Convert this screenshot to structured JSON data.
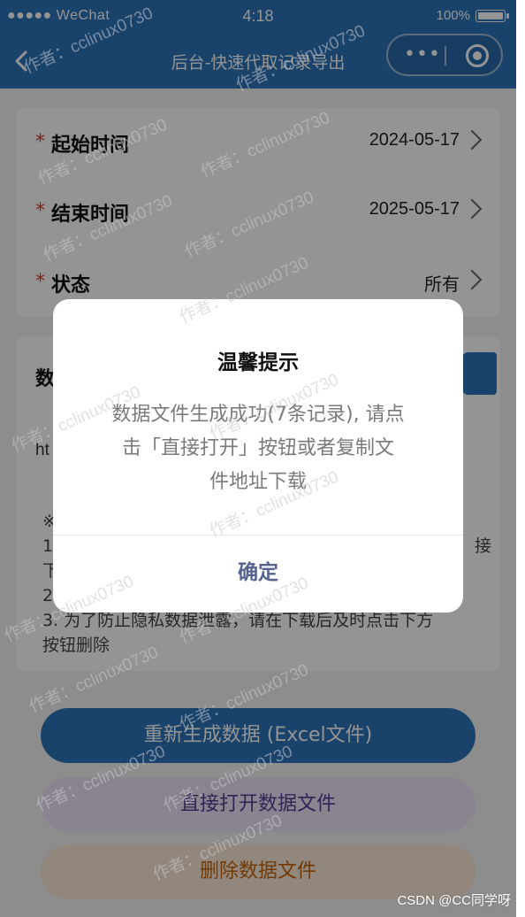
{
  "status_bar": {
    "carrier": "●●●●● WeChat",
    "time": "4:18",
    "battery": "100%"
  },
  "nav": {
    "title": "后台-快速代取记录导出",
    "capsule_more": "•••"
  },
  "form": {
    "required_mark": "*",
    "rows": [
      {
        "label": "起始时间",
        "value": "2024-05-17"
      },
      {
        "label": "结束时间",
        "value": "2025-05-17"
      },
      {
        "label": "状态",
        "value": "所有"
      }
    ]
  },
  "data_section": {
    "label_partial": "数",
    "url_partial": "ht",
    "note_mark": "※",
    "note_lines": [
      {
        "left": "1",
        "right": "接"
      },
      {
        "left": "下",
        "right": ""
      },
      {
        "left": "2",
        "right": ""
      },
      {
        "left": "3. 为了防止隐私数据泄露，请在下载后及时点击下方",
        "right": ""
      },
      {
        "left": "按钮删除",
        "right": ""
      }
    ]
  },
  "buttons": {
    "regenerate": "重新生成数据 (Excel文件)",
    "open": "直接打开数据文件",
    "delete": "删除数据文件"
  },
  "dialog": {
    "title": "温馨提示",
    "message_lines": [
      "数据文件生成成功(7条记录), 请点",
      "击「直接打开」按钮或者复制文",
      "件地址下载"
    ],
    "confirm": "确定"
  },
  "watermark_text": "作者：cclinux0730",
  "footer": {
    "csdn": "CSDN @CC同学呀"
  },
  "colors": {
    "primary": "#2c74b8",
    "required": "#e0332c",
    "dialog_button": "#55648e",
    "open_button_bg": "#ece4f8",
    "delete_button_bg": "#fbe9d8"
  }
}
